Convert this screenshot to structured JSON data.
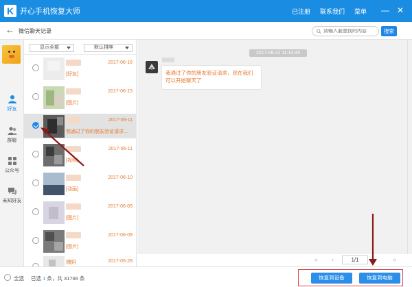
{
  "titlebar": {
    "logo_letter": "K",
    "app_title": "开心手机恢复大师",
    "links": [
      "已注册",
      "联系我们",
      "菜单"
    ],
    "minimize": "—",
    "close": "✕"
  },
  "subheader": {
    "back_icon": "back-arrow-icon",
    "title": "微信聊天记录",
    "search_placeholder": "请输入要查找的内容",
    "search_button": "搜索"
  },
  "sidebar": {
    "items": [
      {
        "label": "好友",
        "icon": "person-icon"
      },
      {
        "label": "群聊",
        "icon": "group-icon"
      },
      {
        "label": "公众号",
        "icon": "grid-icon"
      },
      {
        "label": "未知好友",
        "icon": "unknown-chat-icon"
      }
    ]
  },
  "list": {
    "filter_show": "显示全部",
    "filter_sort": "默认排序",
    "rows": [
      {
        "date": "2017-06-16",
        "preview": "[好友]",
        "name": "",
        "checked": false
      },
      {
        "date": "2017-06-15",
        "preview": "[图片]",
        "name": "",
        "checked": false
      },
      {
        "date": "2017-06-11",
        "preview": "我通过了你的朋友验证请求...",
        "name": "",
        "checked": true
      },
      {
        "date": "2017-06-11",
        "preview": "[视频]",
        "name": "",
        "checked": false
      },
      {
        "date": "2017-06-10",
        "preview": "[动画]",
        "name": "",
        "checked": false
      },
      {
        "date": "2017-06-09",
        "preview": "[图片]",
        "name": "",
        "checked": false
      },
      {
        "date": "2017-06-09",
        "preview": "[图片]",
        "name": "",
        "checked": false
      },
      {
        "date": "2017-05-28",
        "preview": "",
        "name": "姨妈",
        "checked": false
      }
    ]
  },
  "chat": {
    "time": "2017-06-11 11:14:44",
    "message": "我通过了你的朋友验证请求，现在我们可以开始聊天了"
  },
  "pager": {
    "first": "«",
    "prev": "‹",
    "page": "1/1",
    "next": "›",
    "last": "»"
  },
  "bottombar": {
    "select_all": "全选",
    "summary_prefix": "已选",
    "selected_count": "1",
    "summary_mid": "条，共",
    "total_count": "31766",
    "summary_suffix": "条",
    "restore_device": "恢复到设备",
    "restore_pc": "恢复到电脑"
  },
  "colors": {
    "brand_blue": "#1a8de3",
    "accent_orange": "#e6792f",
    "annotation_red": "#d24a4a"
  }
}
